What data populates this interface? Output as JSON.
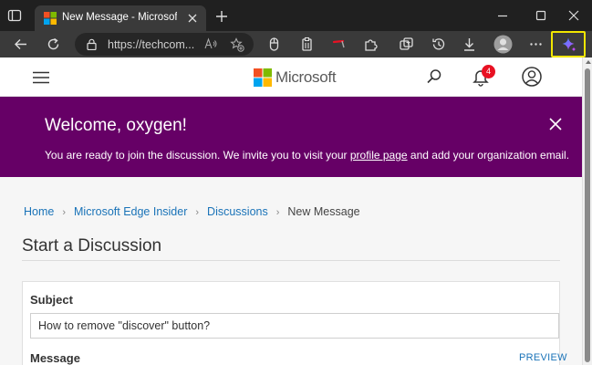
{
  "browser": {
    "tab": {
      "title": "New Message - Microsoft Community Hub"
    },
    "address": {
      "url": "https://techcom..."
    }
  },
  "site": {
    "logo_text": "Microsoft",
    "notification_count": "4"
  },
  "welcome": {
    "title": "Welcome, oxygen!",
    "text_before": "You are ready to join the discussion. We invite you to visit your ",
    "link": "profile page",
    "text_after": " and add your organization email."
  },
  "breadcrumb": [
    "Home",
    "Microsoft Edge Insider",
    "Discussions",
    "New Message"
  ],
  "page_title": "Start a Discussion",
  "form": {
    "subject_label": "Subject",
    "subject_value": "How to remove \"discover\" button?",
    "message_label": "Message",
    "preview_label": "PREVIEW"
  },
  "colors": {
    "banner": "#660066",
    "link": "#1a73b8",
    "badge": "#e81123",
    "copilot_highlight": "#f2e600"
  }
}
